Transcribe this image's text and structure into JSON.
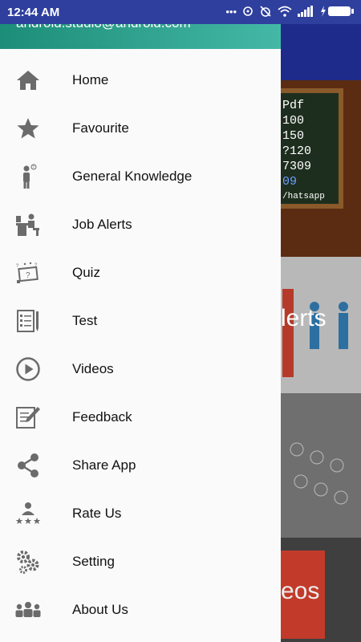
{
  "status_bar": {
    "time": "12:44 AM",
    "icons": [
      "more-icon",
      "sync-icon",
      "alarm-off-icon",
      "wifi-icon",
      "signal-icon",
      "battery-charging-icon"
    ]
  },
  "drawer": {
    "header": {
      "email": "android.studio@android.com",
      "color_start": "#1c8d78",
      "color_end": "#44b8a6"
    },
    "menu": [
      {
        "label": "Home",
        "icon": "home-icon"
      },
      {
        "label": "Favourite",
        "icon": "star-icon"
      },
      {
        "label": "General Knowledge",
        "icon": "thinking-person-icon"
      },
      {
        "label": "Job Alerts",
        "icon": "desk-worker-icon"
      },
      {
        "label": "Quiz",
        "icon": "quiz-icon"
      },
      {
        "label": "Test",
        "icon": "checklist-icon"
      },
      {
        "label": "Videos",
        "icon": "play-circle-icon"
      },
      {
        "label": "Feedback",
        "icon": "edit-note-icon"
      },
      {
        "label": "Share App",
        "icon": "share-icon"
      },
      {
        "label": "Rate Us",
        "icon": "rating-icon"
      },
      {
        "label": "Setting",
        "icon": "gears-icon"
      },
      {
        "label": "About Us",
        "icon": "group-icon"
      }
    ]
  },
  "background": {
    "tile1_lines": [
      "Pdf",
      "100",
      "150",
      "?120",
      "7309",
      "09",
      "/hatsapp"
    ],
    "tile2_text": "lerts",
    "tile4_text": "eos"
  }
}
